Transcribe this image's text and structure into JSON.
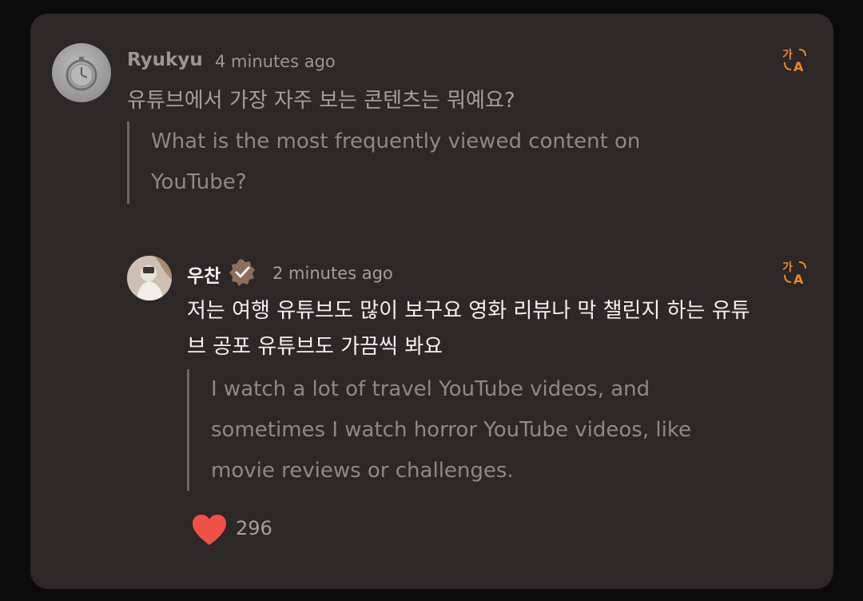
{
  "accent_color": "#f08a1a",
  "comment": {
    "author": "Ryukyu",
    "time": "4 minutes ago",
    "original": "유튜브에서 가장 자주 보는 콘텐츠는 뭐예요?",
    "translation": "What is the most frequently viewed content on YouTube?",
    "avatar_icon": "pocket-watch-avatar",
    "translate_icon": "translate-icon"
  },
  "reply": {
    "author": "우찬",
    "verified_icon": "verified-badge-icon",
    "time": "2 minutes ago",
    "original": "저는 여행 유튜브도 많이 보구요 영화 리뷰나 막 챌린지 하는 유튜브 공포 유튜브도 가끔씩 봐요",
    "translation": "I watch a lot of travel YouTube videos, and sometimes I watch horror YouTube videos, like movie reviews or challenges.",
    "likes": "296",
    "like_icon": "heart-icon",
    "translate_icon": "translate-icon"
  }
}
